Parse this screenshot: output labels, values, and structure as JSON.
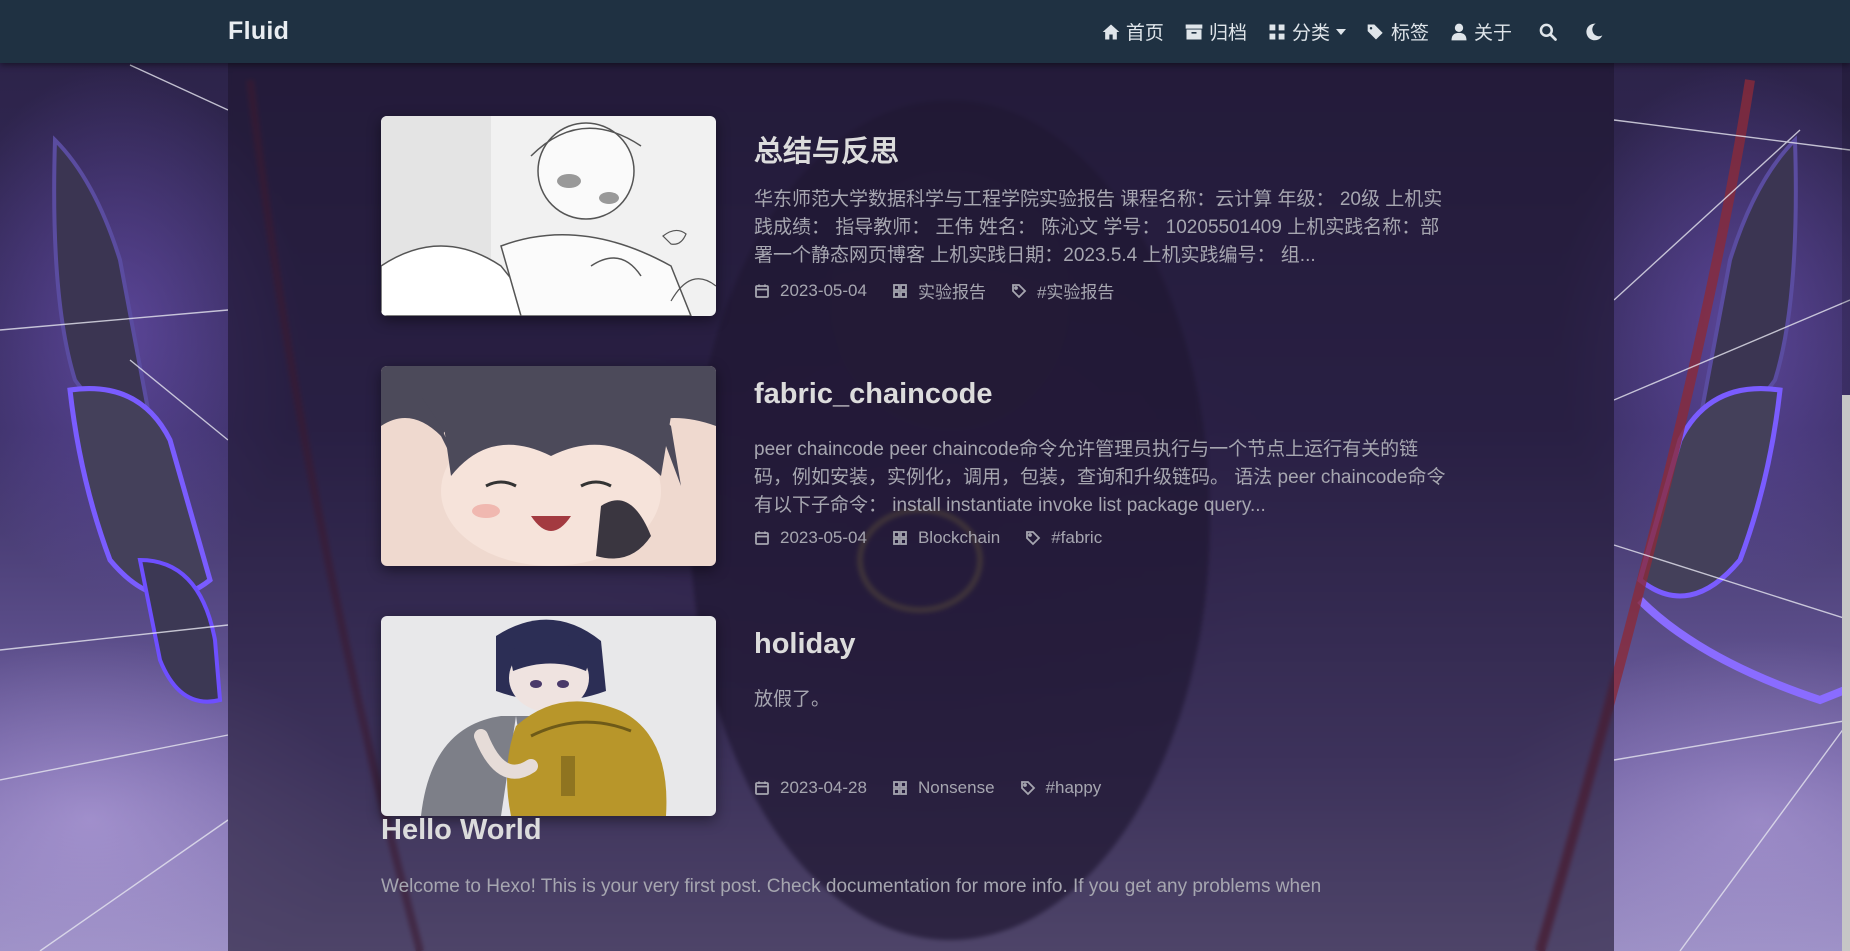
{
  "nav": {
    "brand": "Fluid",
    "items": [
      {
        "label": "首页",
        "icon": "home-icon"
      },
      {
        "label": "归档",
        "icon": "archive-icon"
      },
      {
        "label": "分类",
        "icon": "categories-icon",
        "dropdown": true
      },
      {
        "label": "标签",
        "icon": "tags-icon"
      },
      {
        "label": "关于",
        "icon": "user-icon"
      }
    ],
    "search_icon": "search-icon",
    "theme_icon": "moon-icon"
  },
  "posts": [
    {
      "title": "总结与反思",
      "excerpt": "华东师范大学数据科学与工程学院实验报告 课程名称：云计算 年级： 20级 上机实践成绩： 指导教师： 王伟 姓名： 陈沁文 学号： 10205501409 上机实践名称：部署一个静态网页博客 上机实践日期：2023.5.4 上机实践编号： 组...",
      "date": "2023-05-04",
      "category": "实验报告",
      "tag": "#实验报告"
    },
    {
      "title": "fabric_chaincode",
      "excerpt": "peer chaincode peer chaincode命令允许管理员执行与一个节点上运行有关的链码，例如安装，实例化，调用，包装，查询和升级链码。 语法 peer chaincode命令有以下子命令： install instantiate invoke list package query...",
      "date": "2023-05-04",
      "category": "Blockchain",
      "tag": "#fabric"
    },
    {
      "title": "holiday",
      "excerpt": "放假了。",
      "date": "2023-04-28",
      "category": "Nonsense",
      "tag": "#happy"
    }
  ],
  "hello": {
    "title": "Hello World",
    "excerpt": "Welcome to Hexo! This is your very first post. Check documentation for more info. If you get any problems when"
  },
  "colors": {
    "navbar": "#1f3142",
    "board": "rgba(30,22,48,0.62)",
    "title_text": "#dcdcdc",
    "muted_text": "#a6a6b0"
  }
}
